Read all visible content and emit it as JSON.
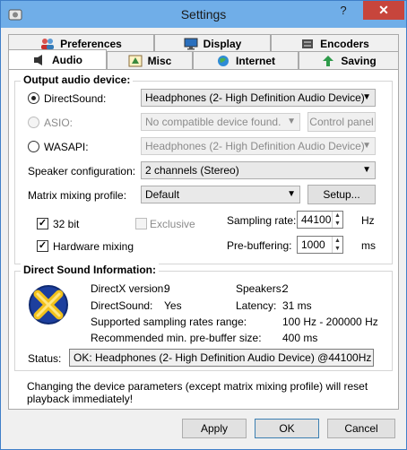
{
  "window": {
    "title": "Settings",
    "help_label": "?",
    "close_label": "✕"
  },
  "tabs": {
    "back": [
      {
        "label": "Preferences",
        "icon": "people-icon"
      },
      {
        "label": "Display",
        "icon": "monitor-icon"
      },
      {
        "label": "Encoders",
        "icon": "encoder-icon"
      }
    ],
    "front": [
      {
        "label": "Audio",
        "icon": "speaker-icon",
        "active": true
      },
      {
        "label": "Misc",
        "icon": "misc-icon"
      },
      {
        "label": "Internet",
        "icon": "globe-icon"
      },
      {
        "label": "Saving",
        "icon": "saving-icon"
      }
    ]
  },
  "output": {
    "title": "Output audio device:",
    "directsound": {
      "label": "DirectSound:",
      "value": "Headphones (2- High Definition Audio Device)",
      "selected": true
    },
    "asio": {
      "label": "ASIO:",
      "value": "No compatible device found.",
      "panel_button": "Control panel"
    },
    "wasapi": {
      "label": "WASAPI:",
      "value": "Headphones (2- High Definition Audio Device)"
    },
    "speaker_config": {
      "label": "Speaker configuration:",
      "value": "2 channels (Stereo)"
    },
    "matrix": {
      "label": "Matrix mixing profile:",
      "value": "Default",
      "setup_button": "Setup..."
    },
    "bit32": {
      "label": "32 bit",
      "checked": true
    },
    "exclusive": {
      "label": "Exclusive",
      "checked": false
    },
    "hardware_mixing": {
      "label": "Hardware mixing",
      "checked": true
    },
    "sampling_rate": {
      "label": "Sampling rate:",
      "value": "44100",
      "unit": "Hz"
    },
    "prebuffering": {
      "label": "Pre-buffering:",
      "value": "1000",
      "unit": "ms"
    }
  },
  "ds_info": {
    "title": "Direct Sound Information:",
    "directx_label": "DirectX version:",
    "directx_value": "9",
    "speakers_label": "Speakers:",
    "speakers_value": "2",
    "directsound_label": "DirectSound:",
    "directsound_value": "Yes",
    "latency_label": "Latency:",
    "latency_value": "31 ms",
    "rates_label": "Supported sampling rates range:",
    "rates_value": "100 Hz - 200000 Hz",
    "prebuf_label": "Recommended min. pre-buffer size:",
    "prebuf_value": "400 ms",
    "status_label": "Status:",
    "status_value": "OK: Headphones (2- High Definition Audio Device) @44100Hz"
  },
  "notice": "Changing the device parameters (except matrix mixing profile) will reset playback immediately!",
  "buttons": {
    "apply": "Apply",
    "ok": "OK",
    "cancel": "Cancel"
  }
}
